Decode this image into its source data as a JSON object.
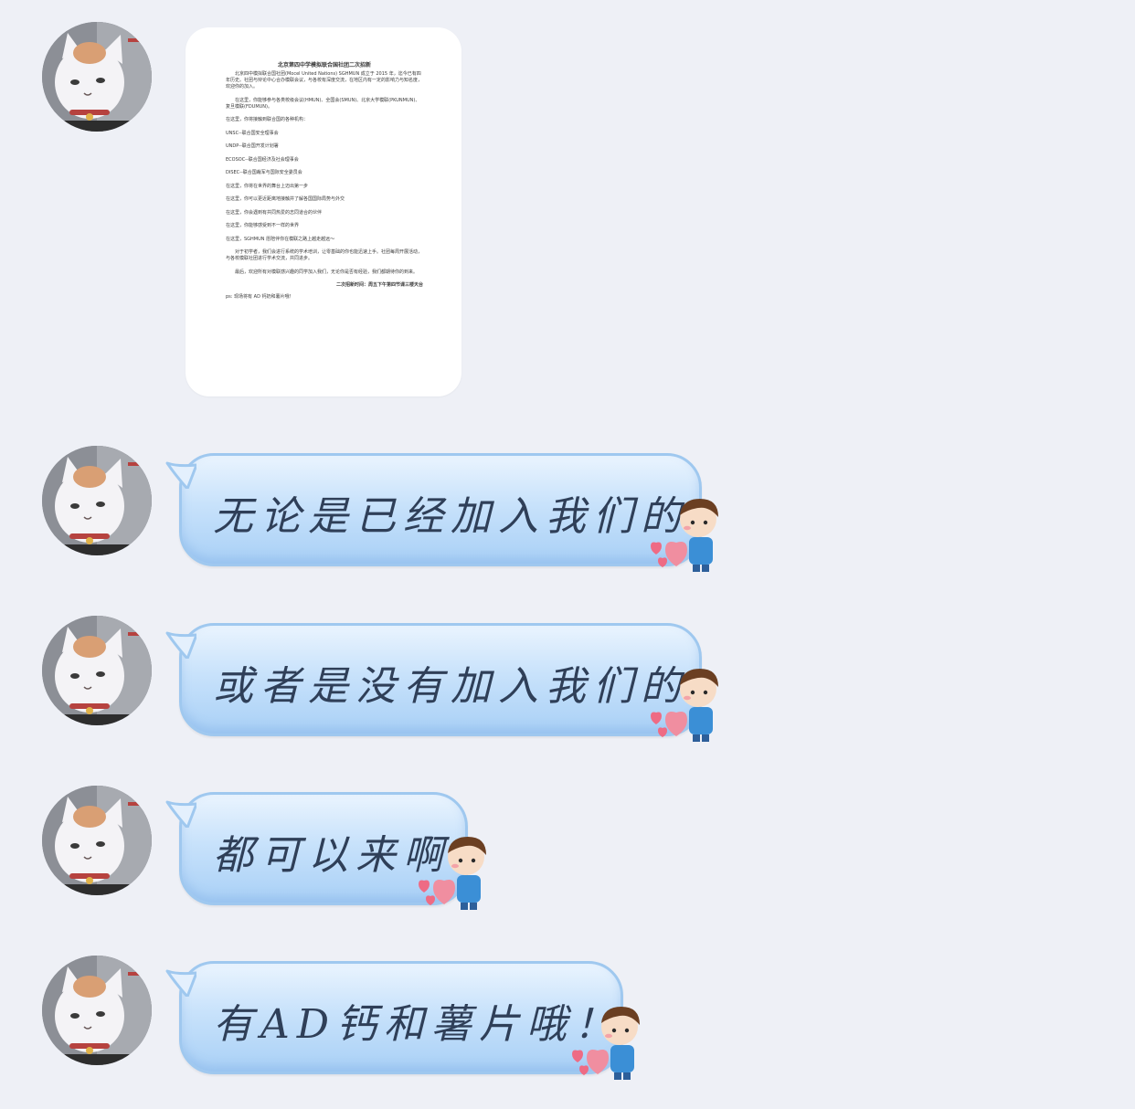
{
  "document_image": {
    "title": "北京第四中学模拟联合国社团二次招新",
    "paragraphs": [
      "北京四中模拟联合国社团(Mocel United Nations) SGHMUN 成立于 2015 年，迄今已有四年历史。社团与辩论中心合办模联会议，与各校有深度交流，在地区内有一定的影响力与知名度，欢迎你的加入。",
      "在这里，你能够参与各类校级会议(HMUN)、全国会(SMUN)、北京大学模联(PKUNMUN)、复旦模联(FDUMUN)。",
      "在这里，你将接触到联合国的各种机构：",
      "UNSC--联合国安全理事会",
      "UNDP--联合国开发计划署",
      "ECOSOC--联合国经济及社会理事会",
      "DISEC--联合国裁军与国际安全委员会",
      "在这里，你将在世界的舞台上迈出第一步",
      "在这里，你可以更近距离地接触并了解各国国际局势与外交",
      "在这里，你会遇到有共同热爱的志同道合的伙伴",
      "在这里，你能够感受到不一样的世界",
      "在这里，SGHMUN 愿陪伴你在模联之路上越走越远～",
      "对于初学者，我们会进行系统的学术培训，让零基础的你也能迅速上手。社团每周开展活动，与各校模联社团进行学术交流，共同进步。",
      "最后，欢迎所有对模联感兴趣的同学加入我们，无论你是否有经验，我们都期待你的到来。",
      "二次招新时间：周五下午第四节课三楼天台",
      "ps: 现场将有 AD 钙奶和薯片哦！"
    ]
  },
  "messages": [
    {
      "text": "无论是已经加入我们的"
    },
    {
      "text": "或者是没有加入我们的"
    },
    {
      "text": "都可以来啊"
    },
    {
      "text": "有AD钙和薯片哦！"
    }
  ],
  "colors": {
    "background": "#eef0f6",
    "bubble_fill": "#c8e2fb",
    "bubble_border": "#9fc8ef",
    "text": "#2f3f58"
  },
  "icons": {
    "avatar": "cat-avatar-icon",
    "sticker": "boy-heart-sticker-icon"
  }
}
